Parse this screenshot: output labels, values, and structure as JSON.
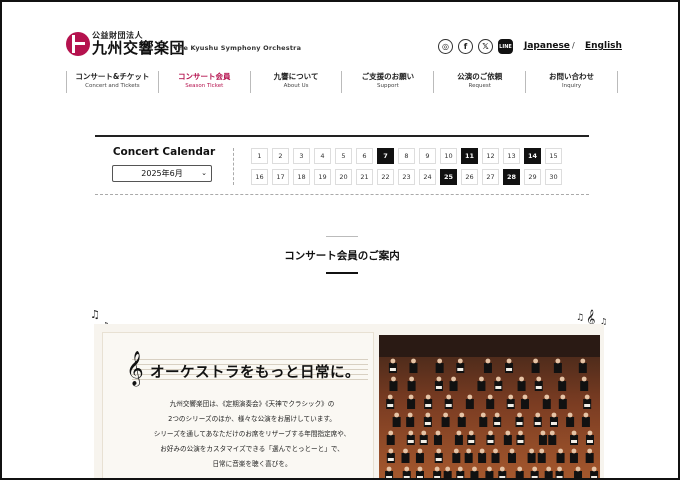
{
  "header": {
    "logo_sub": "公益財団法人",
    "logo_main": "九州交響楽団",
    "logo_en": "The Kyushu Symphony Orchestra",
    "social": [
      {
        "name": "instagram",
        "glyph": "◎"
      },
      {
        "name": "facebook",
        "glyph": "f"
      },
      {
        "name": "x",
        "glyph": "𝕏"
      },
      {
        "name": "line",
        "glyph": "LINE"
      }
    ],
    "lang_japanese": "Japanese",
    "lang_sep": "/",
    "lang_english": "English"
  },
  "nav": [
    {
      "jp": "コンサート&チケット",
      "en": "Concert and Tickets",
      "active": false
    },
    {
      "jp": "コンサート会員",
      "en": "Season Ticket",
      "active": true
    },
    {
      "jp": "九響について",
      "en": "About Us",
      "active": false
    },
    {
      "jp": "ご支援のお願い",
      "en": "Support",
      "active": false
    },
    {
      "jp": "公演のご依頼",
      "en": "Request",
      "active": false
    },
    {
      "jp": "お問い合わせ",
      "en": "Inquiry",
      "active": false
    }
  ],
  "calendar": {
    "title": "Concert Calendar",
    "selected_month": "2025年6月",
    "days": [
      "1",
      "2",
      "3",
      "4",
      "5",
      "6",
      "7",
      "8",
      "9",
      "10",
      "11",
      "12",
      "13",
      "14",
      "15",
      "16",
      "17",
      "18",
      "19",
      "20",
      "21",
      "22",
      "23",
      "24",
      "25",
      "26",
      "27",
      "28",
      "29",
      "30"
    ],
    "concert_days": [
      "7",
      "11",
      "14",
      "25",
      "28"
    ]
  },
  "section": {
    "title": "コンサート会員のご案内"
  },
  "intro": {
    "heading": "オーケストラをもっと日常に。",
    "lines": [
      "九州交響楽団は、《定期演奏会》《天神でクラシック》の",
      "2つのシリーズのほか、様々な公演をお届けしています。",
      "シリーズを通してあなただけのお席をリザーブする年間指定席や、",
      "お好みの公演をカスタマイズできる「選んでとっとーと」で、",
      "日常に音楽を聴く喜びを。"
    ]
  },
  "colors": {
    "accent": "#b5124e",
    "text": "#222222",
    "panel_bg": "#f7f4ee"
  },
  "icons": {
    "treble_clef": "𝄞",
    "music_notes": "♫",
    "select_arrow": "⌄"
  }
}
